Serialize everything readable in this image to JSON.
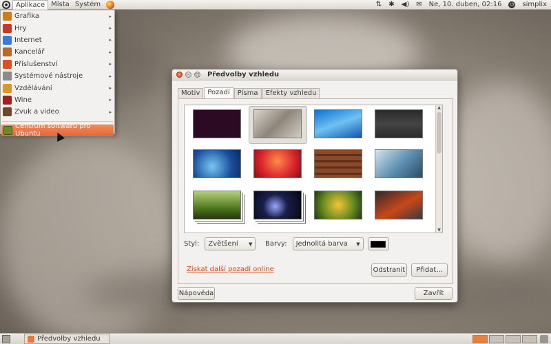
{
  "top_panel": {
    "menus": [
      "Aplikace",
      "Místa",
      "Systém"
    ],
    "clock": "Ne, 10. duben, 02:16",
    "user": "simplix",
    "tray_icons": [
      "network-icon",
      "bluetooth-icon",
      "volume-icon",
      "mail-icon"
    ]
  },
  "app_menu": {
    "items": [
      {
        "label": "Grafika",
        "icon": "graphics-icon",
        "color": "#c8801f"
      },
      {
        "label": "Hry",
        "icon": "games-icon",
        "color": "#c23a2a"
      },
      {
        "label": "Internet",
        "icon": "internet-icon",
        "color": "#3a7bd5"
      },
      {
        "label": "Kancelář",
        "icon": "office-icon",
        "color": "#b36a2a"
      },
      {
        "label": "Příslušenství",
        "icon": "accessories-icon",
        "color": "#d9502a"
      },
      {
        "label": "Systémové nástroje",
        "icon": "system-tools-icon",
        "color": "#8a8a8a"
      },
      {
        "label": "Vzdělávání",
        "icon": "education-icon",
        "color": "#d59b2a"
      },
      {
        "label": "Wine",
        "icon": "wine-icon",
        "color": "#a02020"
      },
      {
        "label": "Zvuk a video",
        "icon": "sound-video-icon",
        "color": "#6a4a2a"
      }
    ],
    "software_center": "Centrum softwaru pro Ubuntu"
  },
  "dialog": {
    "title": "Předvolby vzhledu",
    "tabs": [
      "Motiv",
      "Pozadí",
      "Písma",
      "Efekty vzhledu"
    ],
    "active_tab": "Pozadí",
    "style_label": "Styl:",
    "style_value": "Zvětšení",
    "colors_label": "Barvy:",
    "colors_value": "Jednolitá barva",
    "color_swatch": "#000000",
    "get_more_link": "Získat další pozadí online",
    "remove_button": "Odstranit",
    "add_button": "Přidat...",
    "help_button": "Nápověda",
    "close_button": "Zavřít"
  },
  "wallpapers": [
    {
      "name": "solid-purple",
      "bg": "#2c0a24"
    },
    {
      "name": "grey-warty-bokeh",
      "bg": "linear-gradient(135deg,#d9d4cc,#8e857a 50%,#d2ccc3)"
    },
    {
      "name": "blue-abstract-peak",
      "bg": "linear-gradient(160deg,#0f6fd1,#6fc2f2 50%,#1356b0)"
    },
    {
      "name": "dark-windows",
      "bg": "linear-gradient(#2a2a2a,#444 50%,#2a2a2a)"
    },
    {
      "name": "blue-swirl",
      "bg": "radial-gradient(circle at 40% 60%,#79c7f5,#1a4e9b 60%,#0c2a5c)"
    },
    {
      "name": "red-flowers",
      "bg": "radial-gradient(circle at 50% 40%,#ff8a4a,#d8242c 60%,#8b0d14)"
    },
    {
      "name": "wooden-planks",
      "bg": "repeating-linear-gradient(#8a4a2a 0 6px,#5e2e18 6px 9px)"
    },
    {
      "name": "frozen-branches",
      "bg": "linear-gradient(135deg,#d4e4ef,#5b8cad 55%,#2b4c66)"
    },
    {
      "name": "green-grass",
      "bg": "linear-gradient(#b8cf7a,#4f7a20 60%,#22380c)"
    },
    {
      "name": "night-sky",
      "bg": "radial-gradient(circle at 45% 55%,#9aa7ff,#1a1f4a 40%,#050510)"
    },
    {
      "name": "yellow-flowers",
      "bg": "radial-gradient(circle at 50% 50%,#f5c437,#6d8d22 55%,#1d3a12)"
    },
    {
      "name": "orange-streaks",
      "bg": "linear-gradient(150deg,#2a2a2a,#c9471a 55%,#3a3a3a)"
    }
  ],
  "bottom_panel": {
    "task_label": "Předvolby vzhledu"
  }
}
